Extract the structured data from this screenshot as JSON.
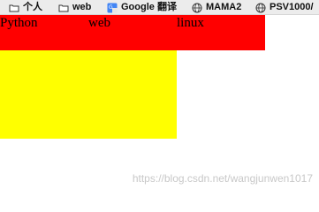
{
  "bookmarks": [
    {
      "label": "个人",
      "icon": "folder-icon"
    },
    {
      "label": "web",
      "icon": "folder-icon"
    },
    {
      "label": "Google 翻译",
      "icon": "google-translate-icon"
    },
    {
      "label": "MAMA2",
      "icon": "globe-icon"
    },
    {
      "label": "PSV1000/",
      "icon": "globe-icon"
    }
  ],
  "nav": {
    "items": [
      "Python",
      "web",
      "linux"
    ],
    "color": "#ff0000"
  },
  "yellow_box": {
    "color": "#ffff00"
  },
  "watermark": "https://blog.csdn.net/wangjunwen1017"
}
